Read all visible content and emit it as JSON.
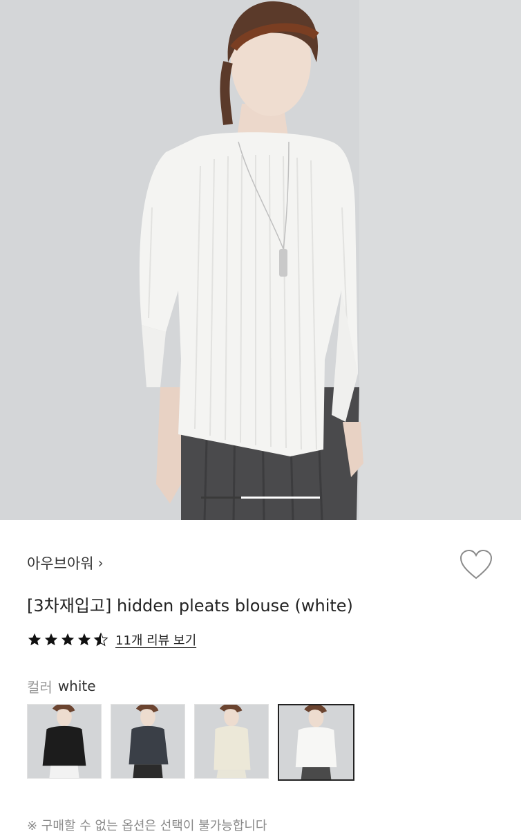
{
  "hero": {
    "image_alt": "model wearing white pleated blouse",
    "pager": {
      "current": 2,
      "total": 2
    }
  },
  "product": {
    "brand": "아우브아워",
    "brand_chevron": "›",
    "title": "[3차재입고] hidden pleats blouse (white)",
    "rating": 4.5,
    "rating_max": 5,
    "review_link": "11개 리뷰 보기",
    "wishlist_icon": "heart-outline-icon"
  },
  "color": {
    "label": "컬러",
    "selected": "white",
    "options": [
      {
        "name": "black",
        "color": "#1c1c1c",
        "pants": "#f2f2f2"
      },
      {
        "name": "charcoal",
        "color": "#3a3f47",
        "pants": "#2b2b2b"
      },
      {
        "name": "cream",
        "color": "#ece8d8",
        "pants": "#e9e6d8"
      },
      {
        "name": "white",
        "color": "#f7f7f5",
        "pants": "#4a4a4a"
      }
    ]
  },
  "notice": "※ 구매할 수 없는 옵션은 선택이 불가능합니다"
}
